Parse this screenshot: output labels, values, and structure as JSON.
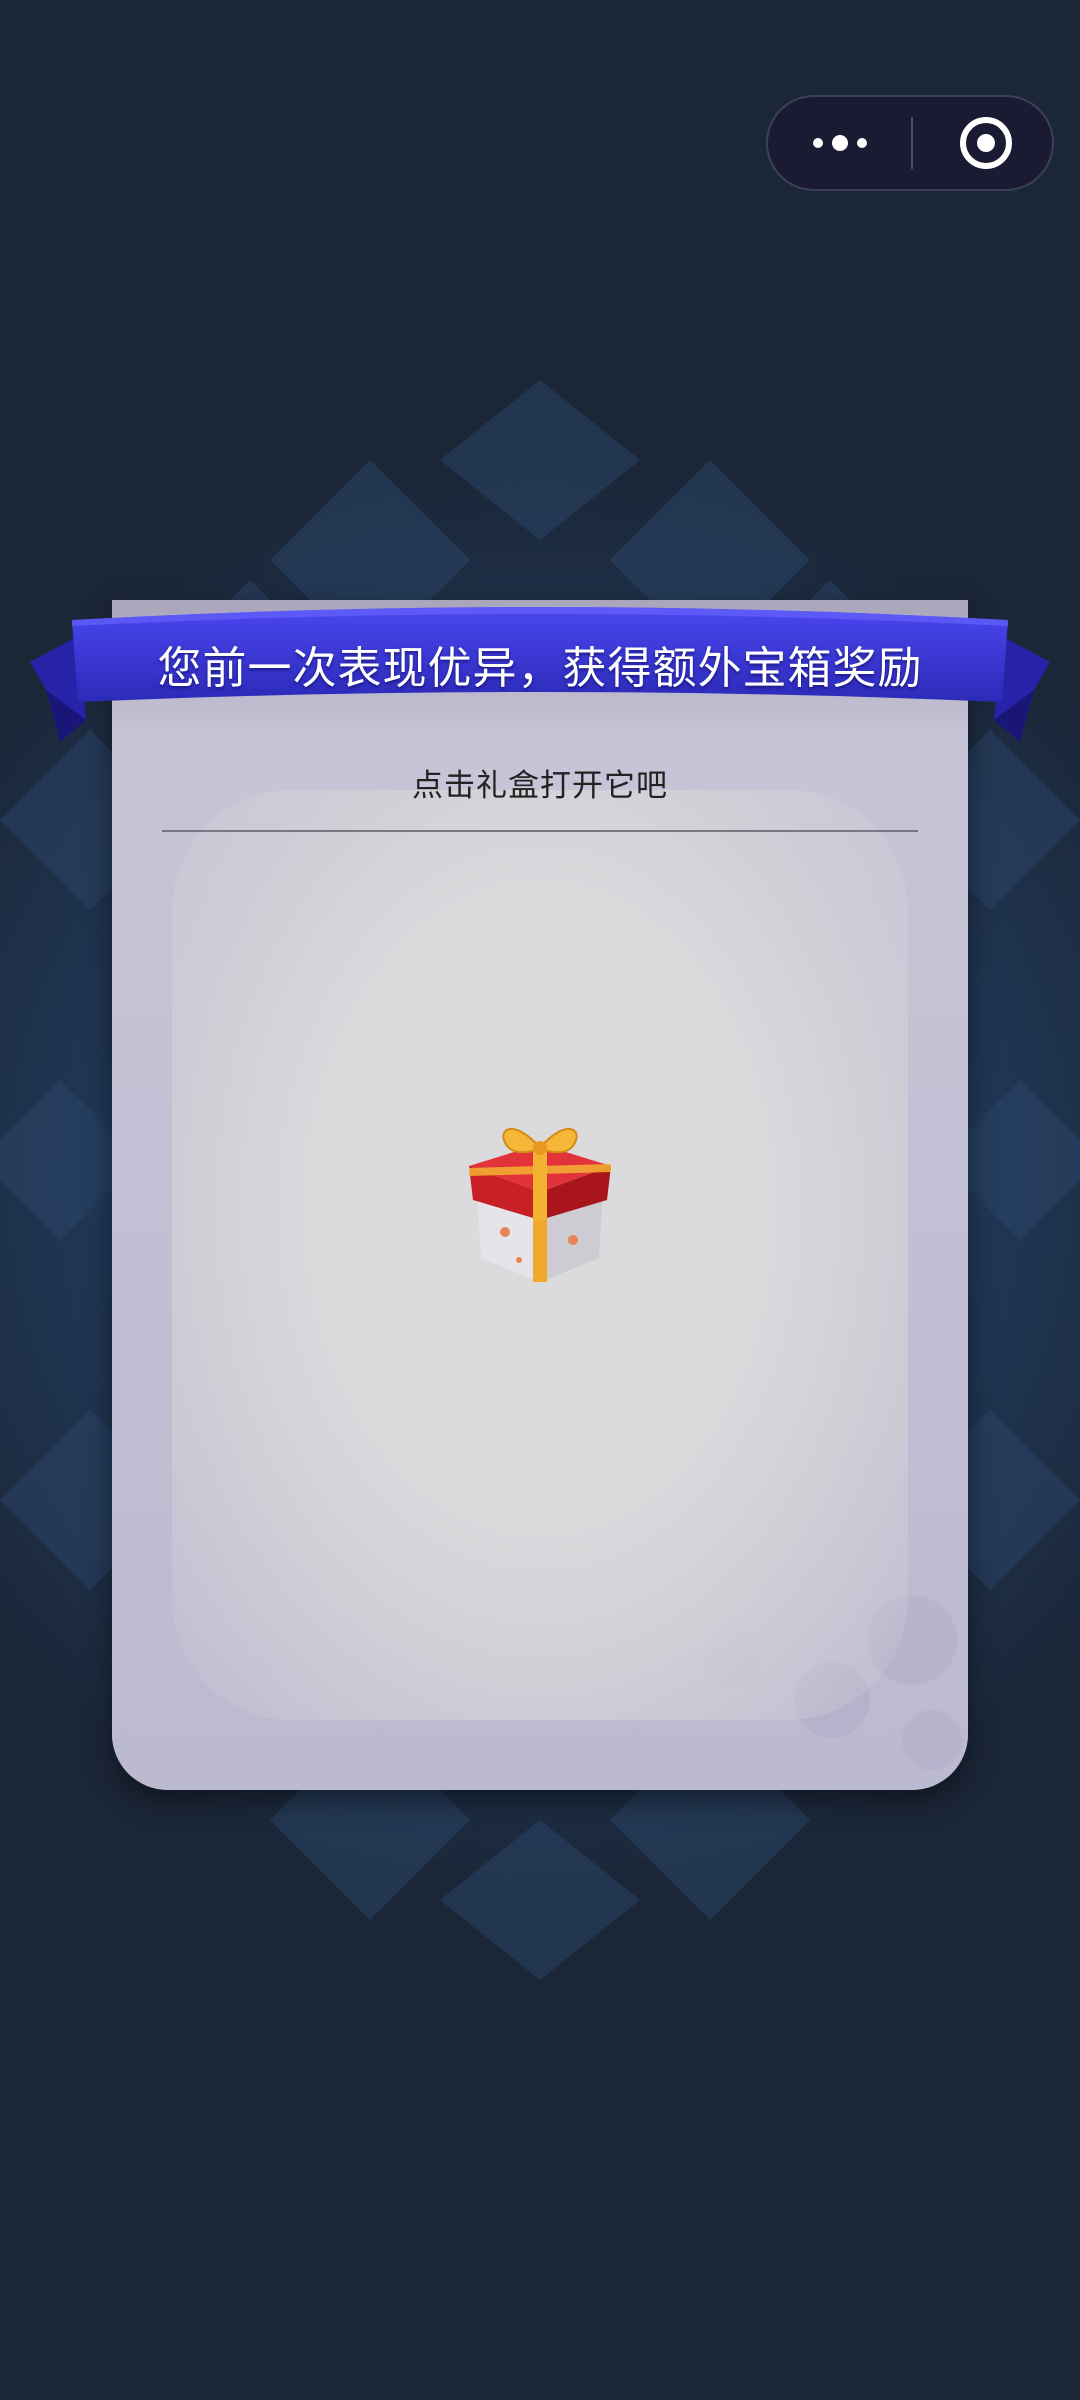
{
  "capsule": {
    "more_icon": "more-dots-icon",
    "close_icon": "close-target-icon"
  },
  "banner": {
    "text": "您前一次表现优异，获得额外宝箱奖励"
  },
  "card": {
    "instruction": "点击礼盒打开它吧",
    "gift_icon": "gift-box-icon"
  },
  "colors": {
    "background": "#1b2637",
    "banner": "#3b35d9",
    "card": "#c4c2d6",
    "gift_lid": "#d6232b",
    "ribbon": "#f0a92a"
  }
}
